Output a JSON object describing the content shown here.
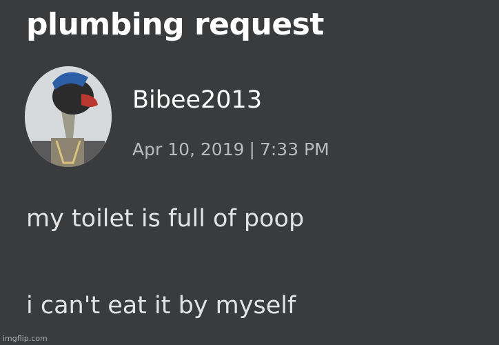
{
  "post": {
    "title": "plumbing request",
    "author": {
      "username": "Bibee2013",
      "avatar_icon": "user-avatar-icon"
    },
    "date": "Apr 10, 2019",
    "separator": "|",
    "time": "7:33 PM",
    "body_lines": [
      "my toilet is full of poop",
      "i can't eat it by myself"
    ]
  },
  "watermark": "imgflip.com",
  "colors": {
    "background": "#393b3d",
    "title": "#ffffff",
    "meta": "#b9bcbf"
  }
}
